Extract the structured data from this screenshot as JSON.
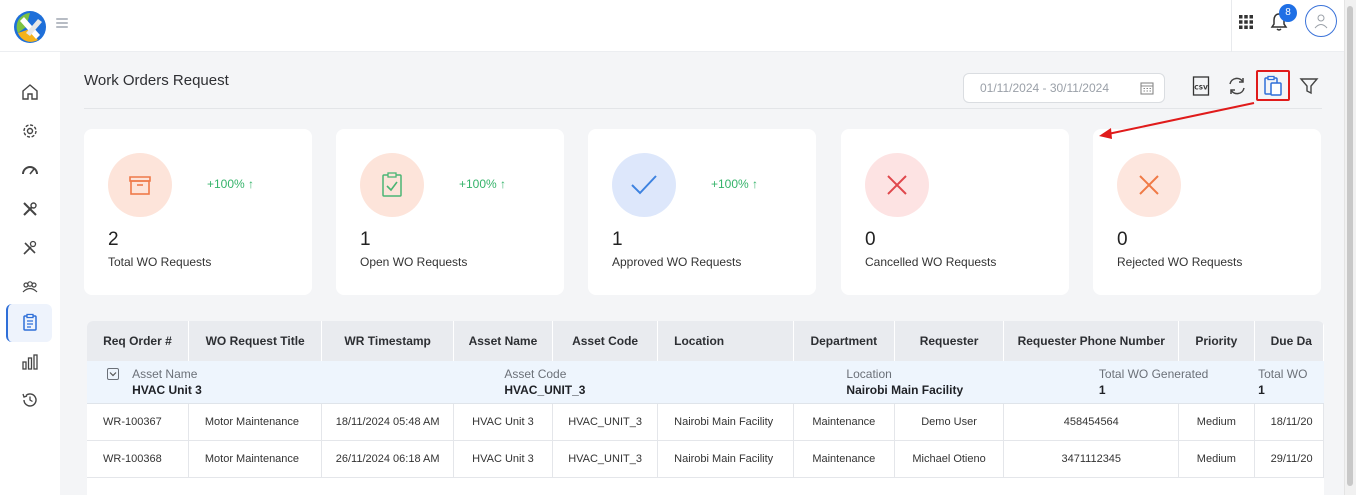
{
  "header": {
    "notification_count": "8"
  },
  "page": {
    "title": "Work Orders Request",
    "date_range": "01/11/2024 - 30/11/2024"
  },
  "toolbar": {
    "csv": "CSV"
  },
  "cards": [
    {
      "value": "2",
      "label": "Total WO Requests",
      "change": "+100% ↑",
      "color": "#fde4da",
      "icon": "box-icon"
    },
    {
      "value": "1",
      "label": "Open WO Requests",
      "change": "+100% ↑",
      "color": "#fde4da",
      "icon": "clipboard-check-icon"
    },
    {
      "value": "1",
      "label": "Approved WO Requests",
      "change": "+100% ↑",
      "color": "#dde7fb",
      "icon": "check-icon"
    },
    {
      "value": "0",
      "label": "Cancelled WO Requests",
      "change": "",
      "color": "#fde3e3",
      "icon": "x-icon"
    },
    {
      "value": "0",
      "label": "Rejected WO Requests",
      "change": "",
      "color": "#fde6de",
      "icon": "x-icon"
    }
  ],
  "table": {
    "columns": [
      "Req Order #",
      "WO Request Title",
      "WR Timestamp",
      "Asset Name",
      "Asset Code",
      "Location",
      "Department",
      "Requester",
      "Requester Phone Number",
      "Priority",
      "Due Da"
    ],
    "group": {
      "asset_name_label": "Asset Name",
      "asset_name": "HVAC Unit 3",
      "asset_code_label": "Asset Code",
      "asset_code": "HVAC_UNIT_3",
      "location_label": "Location",
      "location": "Nairobi Main Facility",
      "total_label": "Total WO Generated",
      "total": "1",
      "total_label2": "Total WO",
      "total2": "1"
    },
    "rows": [
      [
        "WR-100367",
        "Motor Maintenance",
        "18/11/2024 05:48 AM",
        "HVAC Unit 3",
        "HVAC_UNIT_3",
        "Nairobi Main Facility",
        "Maintenance",
        "Demo User",
        "458454564",
        "Medium",
        "18/11/20"
      ],
      [
        "WR-100368",
        "Motor Maintenance",
        "26/11/2024 06:18 AM",
        "HVAC Unit 3",
        "HVAC_UNIT_3",
        "Nairobi Main Facility",
        "Maintenance",
        "Michael Otieno",
        "3471112345",
        "Medium",
        "29/11/20"
      ]
    ]
  },
  "colors": {
    "accent": "#2f6fd8",
    "positive": "#35b36a",
    "annotation": "#e01b1b"
  }
}
